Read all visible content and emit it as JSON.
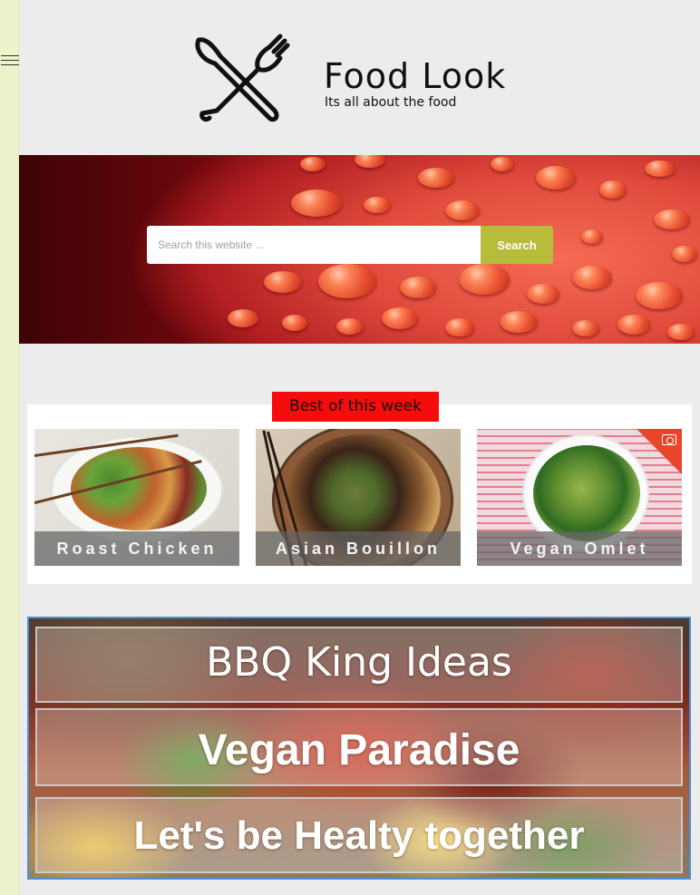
{
  "site": {
    "title": "Food Look",
    "tagline": "Its all about the food",
    "logo_icon": "fork-knife-cross-icon",
    "menu_icon": "hamburger-menu-icon"
  },
  "search": {
    "placeholder": "Search this website ...",
    "button_label": "Search"
  },
  "best_of_week": {
    "heading": "Best of this week",
    "items": [
      {
        "title": "Roast Chicken"
      },
      {
        "title": "Asian Bouillon"
      },
      {
        "title": "Vegan Omlet",
        "badge_icon": "camera-icon"
      }
    ]
  },
  "banners": [
    {
      "label": "BBQ King Ideas"
    },
    {
      "label": "Vegan Paradise"
    },
    {
      "label": "Let's be Healty together"
    }
  ],
  "colors": {
    "accent_green": "#b5bd3b",
    "badge_red": "#f50c0c",
    "sidebar_strip": "#eef3cc",
    "selection_border": "#4a90d9"
  }
}
